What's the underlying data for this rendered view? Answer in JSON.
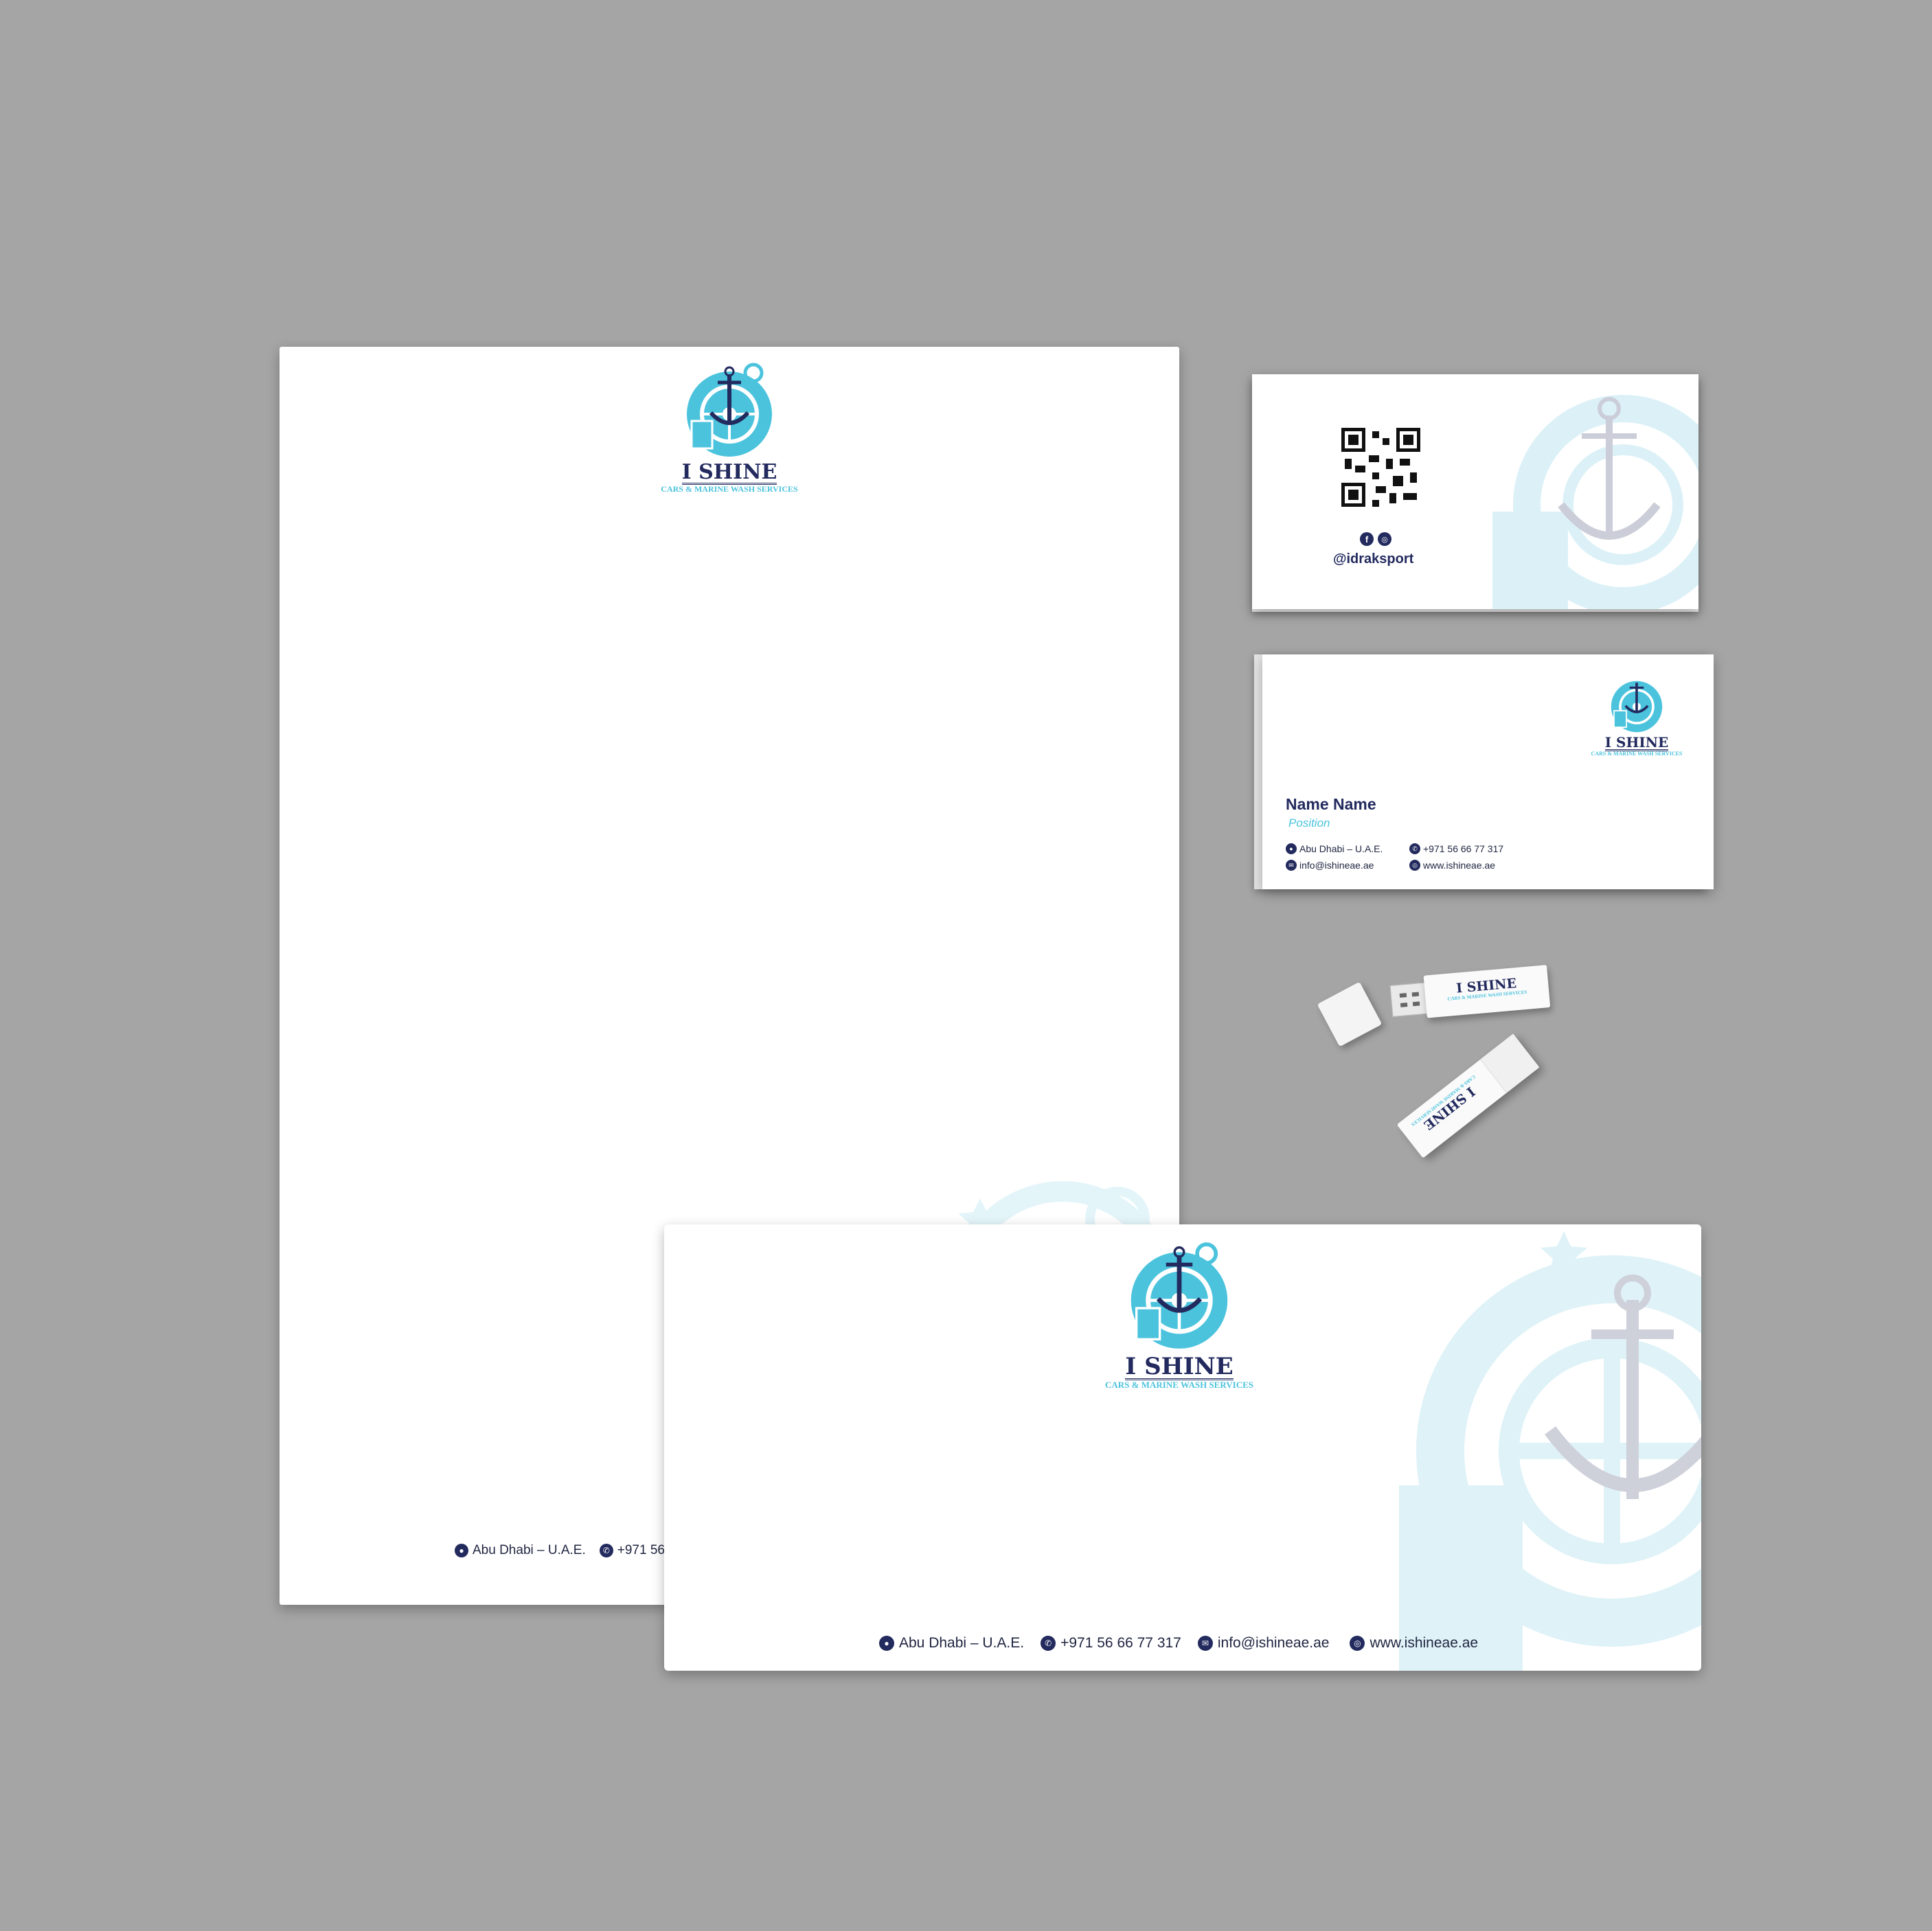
{
  "brand": {
    "name": "I SHINE",
    "tagline": "CARS & MARINE WASH SERVICES"
  },
  "contact": {
    "address": "Abu Dhabi – U.A.E.",
    "phone": "+971 56 66 77 317",
    "email": "info@ishineae.ae",
    "website": "www.ishineae.ae"
  },
  "letterhead": {
    "visible_footer_address": "Abu Dhabi – U.A.E.",
    "visible_footer_phone_fragment": "+971 56"
  },
  "card_back": {
    "social_handle": "@idraksport",
    "social_icons": [
      "facebook-icon",
      "instagram-icon"
    ]
  },
  "card_front": {
    "name": "Name Name",
    "position": "Position"
  },
  "usb": {
    "brand": "I SHINE",
    "tagline": "CARS & MARINE WASH SERVICES"
  },
  "colors": {
    "background": "#a5a5a5",
    "navy": "#222a5e",
    "cyan": "#4bc3dd",
    "watermark_cyan": "#dbf1f7",
    "watermark_gray": "#c9cbd6"
  }
}
